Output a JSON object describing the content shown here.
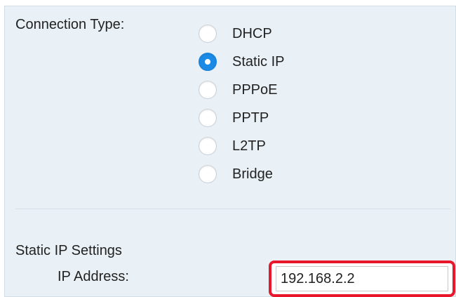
{
  "connection": {
    "label": "Connection Type:",
    "options": [
      {
        "label": "DHCP",
        "checked": false
      },
      {
        "label": "Static IP",
        "checked": true
      },
      {
        "label": "PPPoE",
        "checked": false
      },
      {
        "label": "PPTP",
        "checked": false
      },
      {
        "label": "L2TP",
        "checked": false
      },
      {
        "label": "Bridge",
        "checked": false
      }
    ],
    "selected": "Static IP"
  },
  "static_ip": {
    "section_title": "Static IP Settings",
    "ip_address_label": "IP Address:",
    "ip_address_value": "192.168.2.2"
  },
  "colors": {
    "panel_background": "#e9f1f7",
    "radio_checked": "#1a8ae6",
    "highlight_border": "#e8172c"
  }
}
